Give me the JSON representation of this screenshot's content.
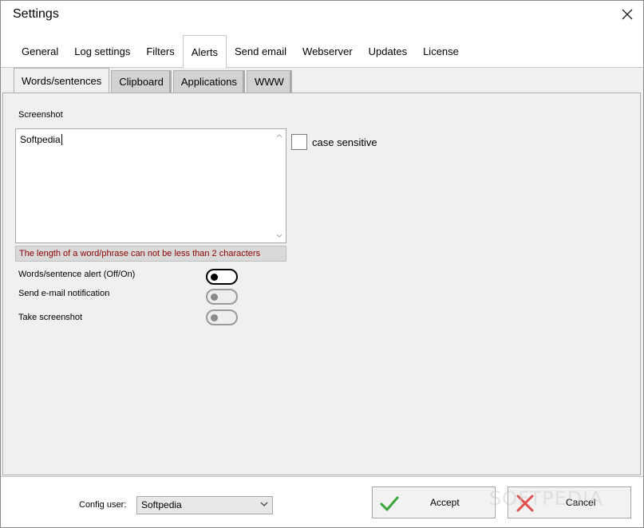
{
  "window": {
    "title": "Settings"
  },
  "main_tabs": [
    {
      "label": "General"
    },
    {
      "label": "Log settings"
    },
    {
      "label": "Filters"
    },
    {
      "label": "Alerts",
      "active": true
    },
    {
      "label": "Send email"
    },
    {
      "label": "Webserver"
    },
    {
      "label": "Updates"
    },
    {
      "label": "License"
    }
  ],
  "sub_tabs": [
    {
      "label": "Words/sentences",
      "active": true
    },
    {
      "label": "Clipboard"
    },
    {
      "label": "Applications"
    },
    {
      "label": "WWW"
    }
  ],
  "words_panel": {
    "section_label": "Screenshot",
    "textarea_value": "Softpedia",
    "hint": "The length of a word/phrase can not be less than 2 characters",
    "case_sensitive_label": "case sensitive",
    "case_sensitive_checked": false,
    "toggles": [
      {
        "label": "Words/sentence alert (Off/On)",
        "on": false,
        "enabled": true
      },
      {
        "label": "Send e-mail notification",
        "on": false,
        "enabled": false
      },
      {
        "label": "Take screenshot",
        "on": false,
        "enabled": false
      }
    ]
  },
  "footer": {
    "config_user_label": "Config user:",
    "config_user_value": "Softpedia",
    "accept_label": "Accept",
    "cancel_label": "Cancel"
  },
  "watermark": "SOFTPEDIA",
  "colors": {
    "accept_icon": "#3aa53a",
    "cancel_icon": "#e05050",
    "hint_text": "#8b0000",
    "panel_bg": "#f0f0f0"
  },
  "icons": {
    "close": "close-icon",
    "accept": "checkmark-icon",
    "cancel": "x-icon",
    "dropdown": "chevron-down-icon"
  }
}
